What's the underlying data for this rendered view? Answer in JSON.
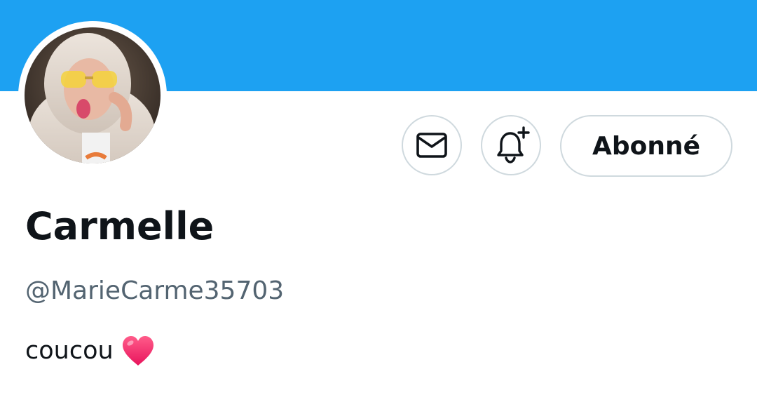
{
  "profile": {
    "display_name": "Carmelle",
    "handle": "@MarieCarme35703",
    "bio_text": "coucou",
    "bio_emoji": "heart-emoji"
  },
  "actions": {
    "message_icon": "envelope-icon",
    "notify_icon": "bell-plus-icon",
    "follow_label": "Abonné"
  },
  "colors": {
    "banner": "#1da1f2",
    "text_primary": "#0f1419",
    "text_secondary": "#536471",
    "button_border": "#cfd9de",
    "heart": "#f91880"
  }
}
